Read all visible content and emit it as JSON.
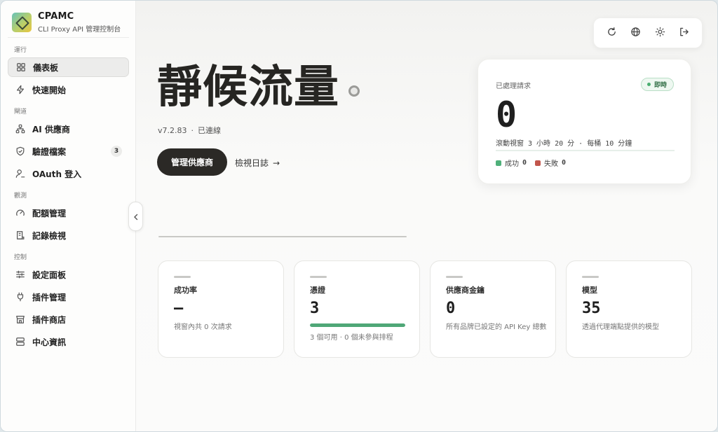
{
  "brand": {
    "name": "CPAMC",
    "subtitle": "CLI Proxy API 管理控制台"
  },
  "sidebar": {
    "sections": [
      {
        "label": "運行"
      },
      {
        "label": "閘道"
      },
      {
        "label": "觀測"
      },
      {
        "label": "控制"
      }
    ],
    "items": [
      {
        "label": "儀表板",
        "icon": "grid-icon",
        "active": true
      },
      {
        "label": "快速開始",
        "icon": "lightning-icon"
      },
      {
        "label": "AI 供應商",
        "icon": "network-icon"
      },
      {
        "label": "驗證檔案",
        "icon": "shield-icon",
        "badge": "3"
      },
      {
        "label": "OAuth 登入",
        "icon": "user-key-icon"
      },
      {
        "label": "配額管理",
        "icon": "gauge-icon"
      },
      {
        "label": "記錄檢視",
        "icon": "log-icon"
      },
      {
        "label": "設定面板",
        "icon": "sliders-icon"
      },
      {
        "label": "插件管理",
        "icon": "plug-icon"
      },
      {
        "label": "插件商店",
        "icon": "store-icon"
      },
      {
        "label": "中心資訊",
        "icon": "server-icon"
      }
    ]
  },
  "toolbar": {
    "buttons": [
      "refresh-icon",
      "globe-icon",
      "sun-icon",
      "logout-icon"
    ]
  },
  "hero": {
    "title": "靜候流量",
    "version": "v7.2.83",
    "connection": "已連線",
    "primary_button": "管理供應商",
    "link_button": "檢視日誌",
    "link_arrow": "→"
  },
  "requests": {
    "label": "已處理請求",
    "badge": "即時",
    "value": "0",
    "window_text": "滾動視窗 3 小時 20 分 · 每桶 10 分鐘",
    "success_label": "成功",
    "success_value": "0",
    "fail_label": "失敗",
    "fail_value": "0",
    "colors": {
      "success": "#4fb07a",
      "fail": "#c2564c",
      "live": "#4bae70"
    }
  },
  "stats": [
    {
      "title": "成功率",
      "value": "—",
      "desc": "視窗內共 0 次請求"
    },
    {
      "title": "憑證",
      "value": "3",
      "progress": 1.0,
      "desc": "3 個可用 · 0 個未參與排程"
    },
    {
      "title": "供應商金鑰",
      "value": "0",
      "desc": "所有品牌已設定的 API Key 總數"
    },
    {
      "title": "模型",
      "value": "35",
      "desc": "透過代理端點提供的模型"
    }
  ]
}
